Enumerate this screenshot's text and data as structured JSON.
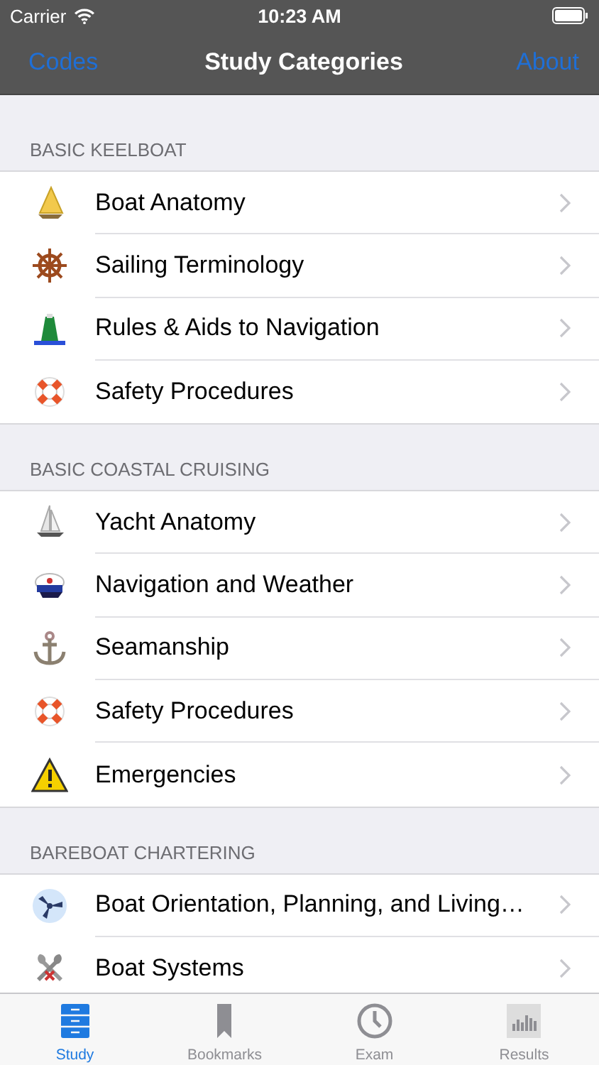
{
  "status_bar": {
    "carrier": "Carrier",
    "time": "10:23 AM"
  },
  "nav_bar": {
    "left": "Codes",
    "title": "Study Categories",
    "right": "About"
  },
  "sections": [
    {
      "header": "BASIC KEELBOAT",
      "items": [
        {
          "label": "Boat Anatomy"
        },
        {
          "label": "Sailing Terminology"
        },
        {
          "label": "Rules & Aids to Navigation"
        },
        {
          "label": "Safety Procedures"
        }
      ]
    },
    {
      "header": "BASIC COASTAL CRUISING",
      "items": [
        {
          "label": "Yacht Anatomy"
        },
        {
          "label": "Navigation and Weather"
        },
        {
          "label": "Seamanship"
        },
        {
          "label": "Safety Procedures"
        },
        {
          "label": "Emergencies"
        }
      ]
    },
    {
      "header": "BAREBOAT CHARTERING",
      "items": [
        {
          "label": "Boat Orientation, Planning, and Living…"
        },
        {
          "label": "Boat Systems"
        }
      ]
    }
  ],
  "tab_bar": [
    {
      "label": "Study",
      "selected": true
    },
    {
      "label": "Bookmarks",
      "selected": false
    },
    {
      "label": "Exam",
      "selected": false
    },
    {
      "label": "Results",
      "selected": false
    }
  ]
}
